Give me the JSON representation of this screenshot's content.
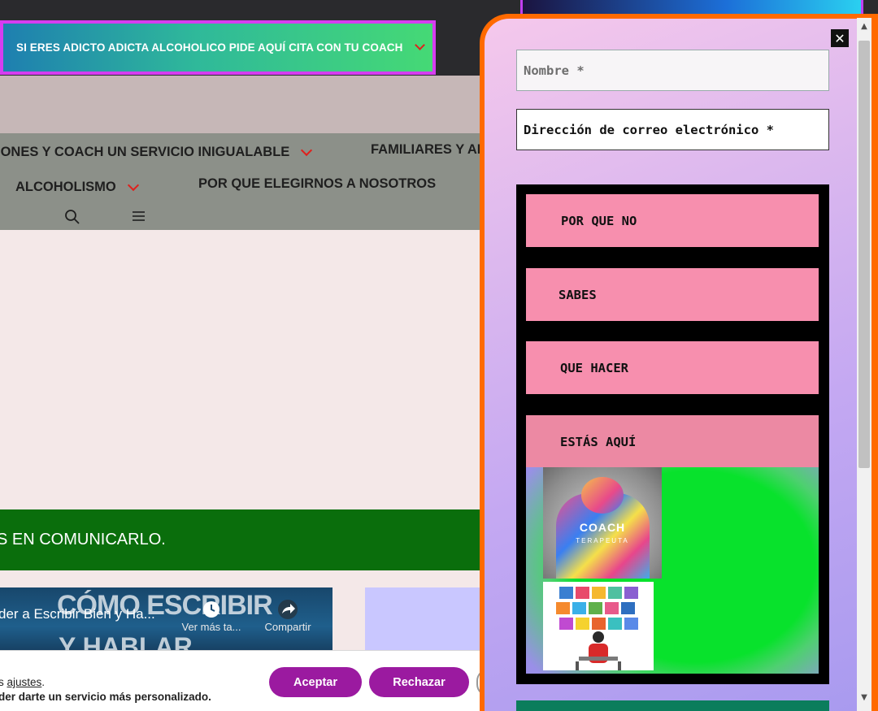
{
  "promo_banner": {
    "text": "SI ERES ADICTO ADICTA ALCOHOLICO PIDE AQUÍ CITA CON TU COACH"
  },
  "nav": {
    "items": [
      {
        "label": "IONES Y COACH UN SERVICIO INIGUALABLE"
      },
      {
        "label": "FAMILIARES Y AL"
      },
      {
        "label": "ALCOHOLISMO"
      },
      {
        "label": "POR QUE ELEGIRNOS A NOSOTROS"
      }
    ]
  },
  "green_band": {
    "text": "S EN COMUNICARLO."
  },
  "video": {
    "title": "der a Escribir Bien y Ha...",
    "overlay_line1": "CÓMO ESCRIBIR",
    "overlay_line2": "Y HABLAR",
    "watch_later": "Ver más ta...",
    "share": "Compartir"
  },
  "cookie": {
    "line1_prefix": "s ",
    "line1_link": "ajustes",
    "line1_suffix": ".",
    "line2": "der darte un servicio más personalizado.",
    "accept": "Aceptar",
    "reject": "Rechazar"
  },
  "popup": {
    "close": "✕",
    "name_placeholder": "Nombre *",
    "email_placeholder": "Dirección de correo electrónico *",
    "menu": [
      {
        "label": "POR QUE NO"
      },
      {
        "label": "SABES"
      },
      {
        "label": "QUE HACER"
      },
      {
        "label": "ESTÁS AQUÍ"
      }
    ],
    "coach_image": {
      "title": "COACH",
      "subtitle": "TERAPEUTA"
    }
  },
  "colors": {
    "accent_orange": "#ff6a00",
    "button_purple": "#9b1aa0",
    "menu_pink": "#f78fae",
    "chevron_red": "#e0201c"
  }
}
